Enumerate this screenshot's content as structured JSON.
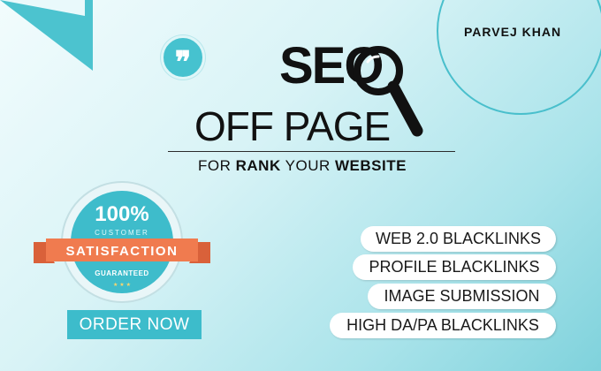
{
  "author": {
    "name": "PARVEJ KHAN"
  },
  "brand": {
    "seo": "SEO"
  },
  "headline": "OFF PAGE",
  "tagline": {
    "pre": "FOR ",
    "bold1": "RANK",
    "mid": " YOUR ",
    "bold2": "WEBSITE"
  },
  "seal": {
    "percent": "100%",
    "customer": "CUSTOMER",
    "satisfaction": "SATISFACTION",
    "guaranteed": "GUARANTEED",
    "stars": "★ ★ ★"
  },
  "cta": {
    "label": "ORDER NOW"
  },
  "services": [
    "WEB 2.0 BLACKLINKS",
    "PROFILE BLACKLINKS",
    "IMAGE SUBMISSION",
    "HIGH DA/PA BLACKLINKS"
  ],
  "colors": {
    "accent": "#46c2cf",
    "ribbon": "#f07b4f",
    "text": "#111111"
  },
  "icons": {
    "quote": "quote-icon",
    "magnifier": "magnifier-icon"
  }
}
